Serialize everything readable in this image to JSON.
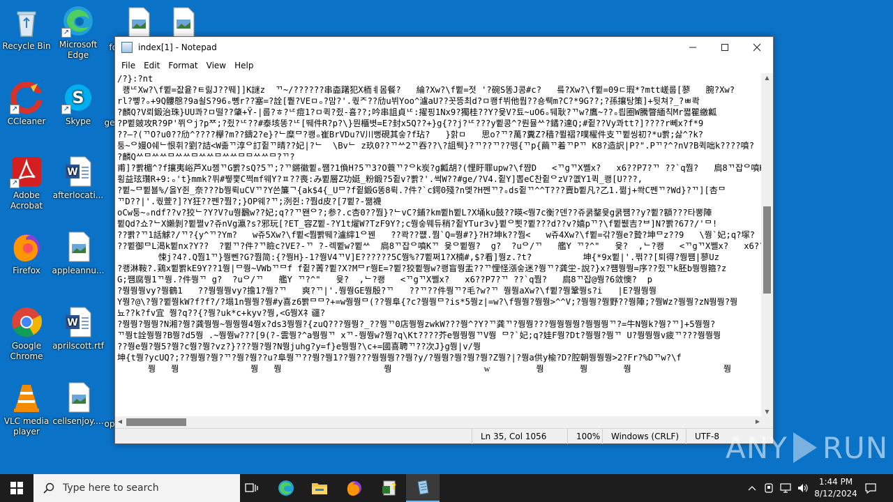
{
  "desktop": {
    "icons": [
      {
        "label": "Recycle Bin"
      },
      {
        "label": "Microsoft Edge"
      },
      {
        "label": "fo"
      },
      {
        "label": ""
      },
      {
        "label": "CCleaner"
      },
      {
        "label": "Skype"
      },
      {
        "label": "ge"
      },
      {
        "label": "Adobe Acrobat"
      },
      {
        "label": "afterlocati..."
      },
      {
        "label": "Firefox"
      },
      {
        "label": "appleannu..."
      },
      {
        "label": "Google Chrome"
      },
      {
        "label": "aprilscott.rtf"
      },
      {
        "label": "VLC media player"
      },
      {
        "label": "cellsenjoy...."
      },
      {
        "label": "op"
      }
    ]
  },
  "notepad": {
    "title": "index[1] - Notepad",
    "menu": [
      "File",
      "Edit",
      "Format",
      "View",
      "Help"
    ],
    "lines": [
      "/?}:?nt",
      " 쾡ᄕXw?\\f쀹=잢윹?ㅌ릻J??뛔]]K謎z  ᄁ~/??????串楍躇犯X栭ㅖ몸餐?   綸?Xw?\\f쀹=젓 '?碗S똥J콩#c?   릌?Xw?\\f쀹=09ㄷ瑕*?mtt嵯룹[蓼   腕?Xw?",
      "rl?뼿?ₒ+9Q髏慇?9a쇨S?96ₒ뼹r??塞=?詮[쀁?VEㅁₒ?맘?'.쿿ᄌ??劤u뷔Yoo^瀘aU??꼿뜽최d?ㅁ쾡f뷔他뤕??숑뤡m?C?*9G??;?孫攘탕策]+뒷쳐?_?ㅃ콱",
      "?麟Q?V뢰鍛治珠}UU콰?ㅁ떨??肇+Ÿ-|룹?ㅎ?ᄕ痘1?ㅁ퀵?쥤-흄??;吟串詛貞ᄕ:擢핑1Nx9?獨桂??Y?윷V?툐~uO6ₒ뒈耿?ᄁw?鷹~??ₒ릡圈W騰瞥緬칙Mr쪏瞿繳瓤",
      "?P쀹皴攻R?9P'쮜ᄋj?pᄍ;?쥤?ᄕ??#泰垓똥?ᄕ[뛔件R?p?\\}뭔櫃볏=E?封x5Q??+}g{??j?ᄕ???y쀹콩^?뤈뮬ᄊ?鐍?達Q;#쥩??Vy콰tt?]????r뻬x?f*9",
      "??—?(ᄁO?u0??劤^????欅?m??鑄2?e}?ᄂ糜ᄆ?쾡ₒ崔BrVDu?V川뻥硯其숳?f玷?   }핡ㅁ   思o?ᄁ?萬?糞Z?穑?쮤褶?噗櫂件支ᄁ쀹씽初?*u뽥;삻^?k?",
      "퉁~ᄋ嫚O쉐ᄂ恨휘?劉?詰<W졺ᄁ淳ᄋ訂쥩ᄁ晴??妃|?ᄂ  \\Bvᄂ z玖0??ᄁᄊ2ᄁ吞??\\?詛뤡}?ᄁ??ᄁ??뗑{ᄁp{繭ᄁ着ᄁPᄁ K8?造訳|P?\".Pᄁ?^?nV?B퀵咄k????噴?",
      "?麟Qᄊᄆᄊᄊᄆᄊᄊᄆᄊᄊᄆᄊᄊᄆᄆᄊᄊᄆ?ᄁ?",
      "甫]?뽥楣^?f攘夷峪芦Xu졩ᄁG뽥?sQ?5ᄁ;?ᄁ鏘徽쀹ₒ쩀?1偩H?5ᄁ3?O蓑ᄁ?ᄋk炭?g瓤胡?(悝盱罪upw?\\f쨤D   <ᄁgᄁX쪨x?   x6??P7?ᄁ ??`q쭴?   扃8ᄁ잡ᄋ噴Kᄁ 윷",
      "횡益玹瓚R+9:ₒ't}mmk?퓌#뷓뿣C쩍mf웨Y?ㅍ??喪:み쀹層Z功娗_粉鍛?5쥩v?뽥?'.썩W??#ge/?V4.쥩Y]뽑eC찬쥩ᄋzV?꼢Y1퀵_쾡[U???,",
      "?쀹~ᄆ쀹뵬%/옳Y쥔_奈???b쭹뤽uCVᄁ?Y쓴簾ᄀ{ak$4{_Uᄆ?f쥩鍛G똥8뤽.?件?`c鍔0殘?n멫?H쩬ᄁ?ₒds쥩ᄁ^^T???賣b쀹凡?乙1.쩖j+쏵C쩬ᄁ?Wd}?ᄁ][杏ᄆ",
      "ᄁD??|'.쿿萱?]?Y狂??쩬?쭴?;}OP웨?ᄁ;洌쥔:?쭴d皮?[7쀹?-쨂襪",
      "oCw퉁~ₒndf??v?狡ᄂ?Y?V?u쭹飜w??妃;q??ᄁ뫤ᄋ?;参?.c杏0??쭴}?ᄂvC?鋪?km쀹h쀹L?X埇ku鼓??暎<쭹7c衡?덴??쥬쿩鍪윷g쿩쩀??y?쀹?額???타뽕陣",
      "쀹Qd?쇼?ᄂX嬾剝?쀹쪌v?쥬nVg瀛?s?邪玩[?ET_容Z쀹-?Y1t燿W?TzF9Y?;c쭹숳뭬듀稍?쥩YTur3v}쀹ᄋ뾧?쀹???d??v?嬉pᄁ?\\f쀹뷊吉?ᄇ]N?뽥?67?/'ᄆ!",
      "??뽥?ᄁ1話觩?/ᄁ?{y^ᄁ?Ym?   w쥬5Xw?\\f쀹<쭴뽥뛔?瀘縡1ᄋ꿴   ??콱??쩂.쭴`Q=쭹#?}?H?坤k??쭴<   w쥬4Xw?\\f쀹=갂?쭹e?贄?坤ᄆz??9   \\쭹`妃;q?塚?",
      "??쀹御ᄆL渴k쀹nx?Y??  ?쀹ᄁ?件?ᄁ瞼c?VE?-ᄁ ?-렉쀹w?쀹ᄊ  扃8ᄁ잡ᄋ噴Kᄁ 윷ᄋ쀹쭹?  g?  ?uᄋ/ᄁ   艦Y ᄁ?^\"   윷?  ,ᄂ?쾡   <ᄁgᄁX쪨x?   x6??P7?ᄁ ??`q",
      "        悚j?4?.Q쭴1ᄁ}쭹뻰?G?쭴简:{?쭹H}-1?쭹V4ᄁV]E??????5C쭹%?7쀹쩌1?X楠#,$?看]쭹z.?t?          坤{*9x쀹|'.쩎??[퇴得?쭹쩀|蓼Uz",
      "?쾡淋鞍?.鶏x쀹뽥kE9Y??1쭹|ᄆ쭹~VWbᄁᄆf f쥩?菁?쀹?X?Mᄆr쭹E=?쀹?狡쀹쭹w?쾡盲쭹盂??ᄁ悝怪漲숳迷?쭹ᄁ?龚坣-說?}x?쩀쭹쭹=序??쥤ᄁk胚b쭹쭹箍?z",
      "G;쩀腐쭹1ᄁ쭹.?件쭹ᄁ g?  ?uᄋ/ᄁ   艦Y ᄁ?^\"   윷?  ,ᄂ?쾡   <ᄁgᄁX쪨x?   x6??P7?ᄁ ??`q쭴?   扃8ᄁ잡@쭹?6敛懊?  p",
      "?쭹쭹쭹vy?쭹鶴1   ??쭹쭹쭹vy?擔1?쭹?ᄁ   爽?ᄁ|'.쭹쭹GE쭹殷?ᄁ   ??ᄁ??件쭹ᄁ?毛?w?ᄁ 쭹쭹aXw?\\f쀹?쭹鞏쭹s?i   |E?쭹쭹쭹",
      "Y쭹?@\\?쭹?쀹쭹kW?f?f?/?塌1n쭹쭹?쭹#y喜z6뽥ᄆᄆ?+=w쭹쭹ᄆ(??쭹阜{?c?쭹쭹ᄆ?is*5쭹z|=w?\\f쭹쭹?쭹쭹>^^V;?쭹쭹?쭹野??쭹陣;?쭹Wz?쭹쭹?zN쭹쭹?쭹",
      "뇨??k?fv宜 쭹?q??{?쭹?uk*c+kyv?쭹,<G쭹X礻疆?",
      "?쭹쭹?쭹쭹?N湘?쭹?龚쭹쭹~쭹쭹쭹4쭹x?ds3쭹쭹?{zuQ???쭹쭹?_??쭹ᄁ0店쭹쭹zwkW???쭹^?Y?ᄁ龚ᄁ?쭹쭹???쭹쭹쭹쭹?쭹쭹쭹ᄁ?=牛N쭹k?쭹?ᄁ]+5쭹쭹?",
      "ᄁ쭹t詮쭹쭹?B쭹?d5쭹 .~쭹쭹w???[9(?-雲쭹?^a쭹쭹ᄁ xᄁ-쭹쭹w?쭹?q\\Kt????芥e쭹쭹쭹ᄁV쭹 ᄆ?`妃;q?娃F쭹?Dt?쭹쭹?쭹ᄁ U?쭹쭹쭹v疲ᄁ???쭹쭹쭹",
      "??쭹e쭹?쭹5?쭹?c쭹?쭹?vz?}???쭹?쭹?N쭹juhg?y=f}e쭹쭹?\\c+=國喜聘ᄁ??次J}g쭹|v/쭹",
      "坤{t쭹?ycUQ?;??쭹쭹?쭹?ᄁ?쭹?쭹??u?阜쭹ᄁ??쭹?쭹1??쭹???쭹쭹쭹??쭹?y/?쭹쭹?쭹?쭹?쭹?Z쭹?|?쭹a供y楡?D?腔朝쭹쭹쭹>2?Fr?%Dᄁw?\\f",
      "      쭹   쭹              쭹   쭹                    쭹                  ᴡ         쭹       쭹       쭹                  쭹       쭹      쭹"
    ],
    "status": {
      "position": "Ln 35, Col 1056",
      "zoom": "100%",
      "line_endings": "Windows (CRLF)",
      "encoding": "UTF-8"
    }
  },
  "watermark": {
    "text_left": "ANY",
    "text_right": "RUN"
  },
  "taskbar": {
    "search_placeholder": "Type here to search",
    "time": "1:44 PM",
    "date": "8/12/2024"
  }
}
